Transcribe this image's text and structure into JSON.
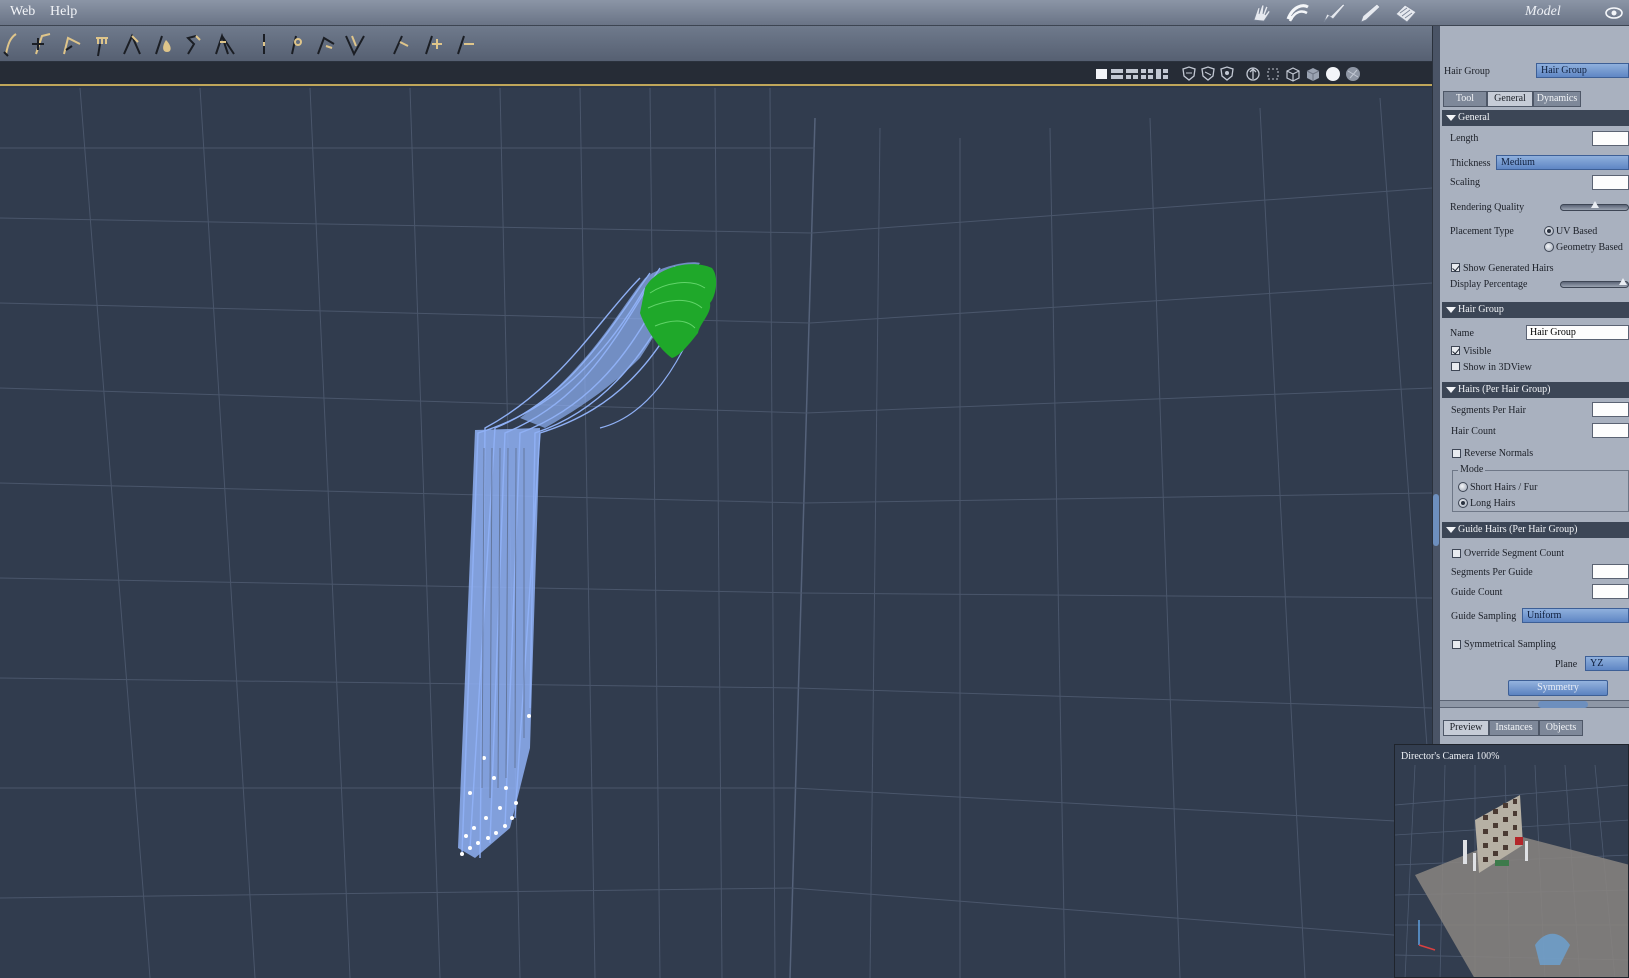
{
  "menu": {
    "items": [
      "Web",
      "Help"
    ]
  },
  "room": {
    "label": "Model",
    "icons": [
      "hand-icon",
      "hair-room-icon",
      "brush-room-icon",
      "pen-room-icon",
      "cloth-room-icon"
    ]
  },
  "panel": {
    "hair_group_label": "Hair Group",
    "hair_group_select": "Hair Group",
    "tabs": [
      "Tool",
      "General",
      "Dynamics"
    ],
    "active_tab": "General",
    "general": {
      "header": "General",
      "length_label": "Length",
      "length_value": "",
      "thickness_label": "Thickness",
      "thickness_value": "Medium",
      "scaling_label": "Scaling",
      "scaling_value": "",
      "rendering_quality_label": "Rendering Quality",
      "placement_type_label": "Placement Type",
      "placement_uv": "UV Based",
      "placement_geometry": "Geometry Based",
      "show_generated_label": "Show Generated Hairs",
      "display_percentage_label": "Display Percentage"
    },
    "hair_group": {
      "header": "Hair Group",
      "name_label": "Name",
      "name_value": "Hair Group",
      "visible_label": "Visible",
      "show_in_3dview_label": "Show in 3DView"
    },
    "hairs": {
      "header": "Hairs (Per Hair Group)",
      "segments_label": "Segments Per Hair",
      "hair_count_label": "Hair Count",
      "reverse_normals_label": "Reverse Normals",
      "mode_label": "Mode",
      "mode_short": "Short Hairs / Fur",
      "mode_long": "Long Hairs"
    },
    "guide": {
      "header": "Guide Hairs (Per Hair Group)",
      "override_label": "Override Segment Count",
      "segments_label": "Segments Per Guide",
      "guide_count_label": "Guide Count",
      "sampling_label": "Guide Sampling",
      "sampling_value": "Uniform",
      "symmetrical_label": "Symmetrical Sampling",
      "plane_label": "Plane",
      "plane_value": "YZ",
      "symmetry_button": "Symmetry"
    }
  },
  "preview": {
    "tabs": [
      "Preview",
      "Instances",
      "Objects"
    ],
    "active_tab": "Preview",
    "camera_label": "Director's Camera 100%"
  },
  "colors": {
    "hair": "#8fb0f5",
    "scalp": "#1fa82a",
    "accent": "#5f86c4"
  }
}
